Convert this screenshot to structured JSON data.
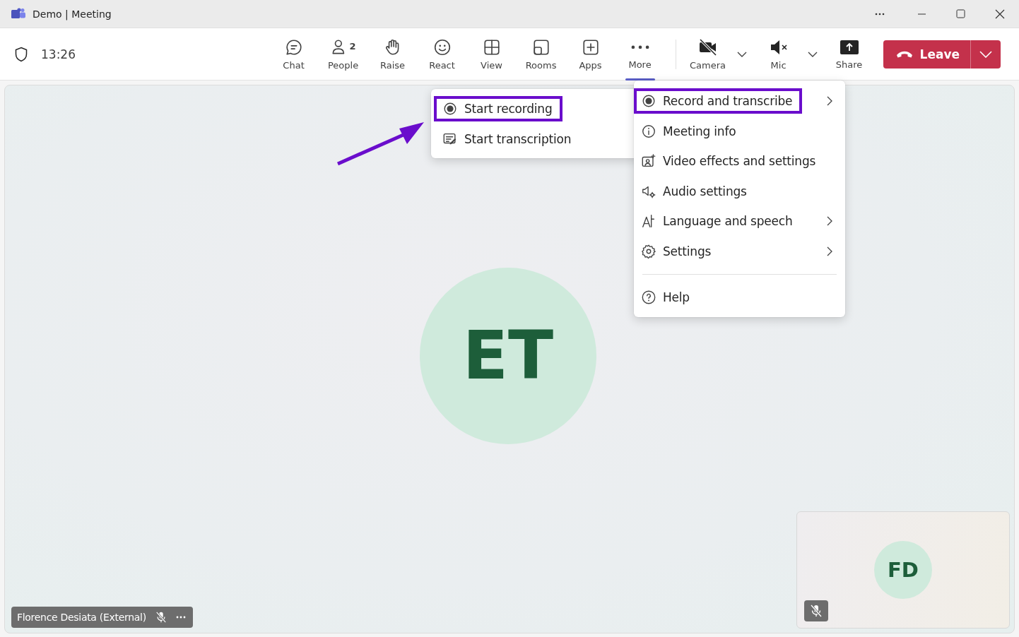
{
  "window": {
    "title": "Demo | Meeting"
  },
  "meeting": {
    "time": "13:26"
  },
  "toolbar": {
    "items": [
      {
        "kind": "chat",
        "label": "Chat",
        "selected": false
      },
      {
        "kind": "people",
        "label": "People",
        "badge": "2",
        "selected": false
      },
      {
        "kind": "raise",
        "label": "Raise",
        "selected": false
      },
      {
        "kind": "react",
        "label": "React",
        "selected": false
      },
      {
        "kind": "view",
        "label": "View",
        "selected": false
      },
      {
        "kind": "rooms",
        "label": "Rooms",
        "selected": false
      },
      {
        "kind": "apps",
        "label": "Apps",
        "selected": false
      },
      {
        "kind": "more",
        "label": "More",
        "selected": true
      }
    ],
    "devices": [
      {
        "kind": "camera",
        "label": "Camera",
        "off": true
      },
      {
        "kind": "mic",
        "label": "Mic",
        "off": true
      }
    ],
    "share": {
      "label": "Share"
    },
    "leave": {
      "label": "Leave"
    }
  },
  "more_menu": {
    "groups": [
      [
        {
          "kind": "record",
          "label": "Record and transcribe",
          "submenu": true,
          "highlighted": true
        },
        {
          "kind": "info",
          "label": "Meeting info",
          "submenu": false,
          "highlighted": false
        },
        {
          "kind": "video",
          "label": "Video effects and settings",
          "submenu": false,
          "highlighted": false
        },
        {
          "kind": "audio",
          "label": "Audio settings",
          "submenu": false,
          "highlighted": false
        },
        {
          "kind": "language",
          "label": "Language and speech",
          "submenu": true,
          "highlighted": false
        },
        {
          "kind": "settings",
          "label": "Settings",
          "submenu": true,
          "highlighted": false
        }
      ],
      [
        {
          "kind": "help",
          "label": "Help",
          "submenu": false,
          "highlighted": false
        }
      ]
    ]
  },
  "submenu": {
    "items": [
      {
        "kind": "record",
        "label": "Start recording",
        "highlighted": true
      },
      {
        "kind": "transcription",
        "label": "Start transcription",
        "highlighted": false
      }
    ]
  },
  "stage": {
    "main": {
      "initials": "ET",
      "name": "Florence Desiata (External)",
      "muted": true
    },
    "self_view": {
      "initials": "FD",
      "muted": true
    }
  }
}
